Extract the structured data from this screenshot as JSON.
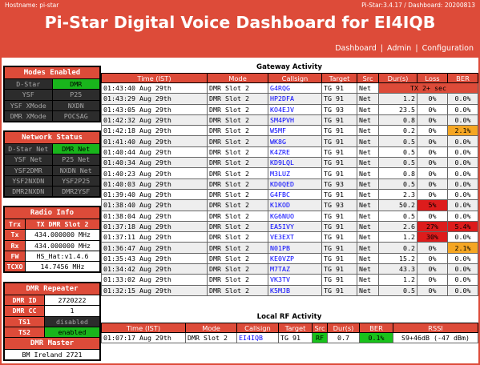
{
  "header": {
    "hostname": "Hostname: pi-star",
    "version": "Pi-Star:3.4.17 / Dashboard: 20200813",
    "title": "Pi-Star Digital Voice Dashboard for EI4IQB",
    "nav": [
      "Dashboard",
      "Admin",
      "Configuration"
    ]
  },
  "modes": {
    "title": "Modes Enabled",
    "items": [
      {
        "label": "D-Star",
        "on": false
      },
      {
        "label": "DMR",
        "on": true
      },
      {
        "label": "YSF",
        "on": false
      },
      {
        "label": "P25",
        "on": false
      },
      {
        "label": "YSF XMode",
        "on": false
      },
      {
        "label": "NXDN",
        "on": false
      },
      {
        "label": "DMR XMode",
        "on": false
      },
      {
        "label": "POCSAG",
        "on": false
      }
    ]
  },
  "network": {
    "title": "Network Status",
    "items": [
      {
        "label": "D-Star Net",
        "on": false
      },
      {
        "label": "DMR Net",
        "on": true
      },
      {
        "label": "YSF Net",
        "on": false
      },
      {
        "label": "P25 Net",
        "on": false
      },
      {
        "label": "YSF2DMR",
        "on": false
      },
      {
        "label": "NXDN Net",
        "on": false
      },
      {
        "label": "YSF2NXDN",
        "on": false
      },
      {
        "label": "YSF2P25",
        "on": false
      },
      {
        "label": "DMR2NXDN",
        "on": false
      },
      {
        "label": "DMR2YSF",
        "on": false
      }
    ]
  },
  "radio": {
    "title": "Radio Info",
    "rows": [
      {
        "label": "Trx",
        "value": "TX DMR Slot 2",
        "highlight": true
      },
      {
        "label": "Tx",
        "value": "434.000000 MHz",
        "highlight": false
      },
      {
        "label": "Rx",
        "value": "434.000000 MHz",
        "highlight": false
      },
      {
        "label": "FW",
        "value": "HS_Hat:v1.4.6",
        "highlight": false
      },
      {
        "label": "TCXO",
        "value": "14.7456 MHz",
        "highlight": false
      }
    ]
  },
  "repeater": {
    "title": "DMR Repeater",
    "rows": [
      {
        "label": "DMR ID",
        "value": "2720222",
        "state": "plain"
      },
      {
        "label": "DMR CC",
        "value": "1",
        "state": "plain"
      },
      {
        "label": "TS1",
        "value": "disabled",
        "state": "off"
      },
      {
        "label": "TS2",
        "value": "enabled",
        "state": "on"
      }
    ],
    "master_title": "DMR Master",
    "master_value": "BM Ireland 2721"
  },
  "gateway": {
    "title": "Gateway Activity",
    "columns": [
      "Time (IST)",
      "Mode",
      "Callsign",
      "Target",
      "Src",
      "Dur(s)",
      "Loss",
      "BER"
    ],
    "rows": [
      {
        "time": "01:43:40 Aug 29th",
        "mode": "DMR Slot 2",
        "callsign": "G4RQG",
        "target": "TG 91",
        "src": "Net",
        "dur": "",
        "loss": "",
        "ber": "",
        "tx": "TX 2+ sec"
      },
      {
        "time": "01:43:29 Aug 29th",
        "mode": "DMR Slot 2",
        "callsign": "HP2DFA",
        "target": "TG 91",
        "src": "Net",
        "dur": "1.2",
        "loss": "0%",
        "ber": "0.0%"
      },
      {
        "time": "01:43:05 Aug 29th",
        "mode": "DMR Slot 2",
        "callsign": "KO4EJV",
        "target": "TG 93",
        "src": "Net",
        "dur": "23.5",
        "loss": "0%",
        "ber": "0.0%"
      },
      {
        "time": "01:42:32 Aug 29th",
        "mode": "DMR Slot 2",
        "callsign": "SM4PVH",
        "target": "TG 91",
        "src": "Net",
        "dur": "0.8",
        "loss": "0%",
        "ber": "0.0%"
      },
      {
        "time": "01:42:18 Aug 29th",
        "mode": "DMR Slot 2",
        "callsign": "W5MF",
        "target": "TG 91",
        "src": "Net",
        "dur": "0.2",
        "loss": "0%",
        "ber": "2.1%",
        "ber_level": "warn"
      },
      {
        "time": "01:41:40 Aug 29th",
        "mode": "DMR Slot 2",
        "callsign": "WK8G",
        "target": "TG 91",
        "src": "Net",
        "dur": "0.5",
        "loss": "0%",
        "ber": "0.0%"
      },
      {
        "time": "01:40:44 Aug 29th",
        "mode": "DMR Slot 2",
        "callsign": "K4ZRE",
        "target": "TG 91",
        "src": "Net",
        "dur": "0.5",
        "loss": "0%",
        "ber": "0.0%"
      },
      {
        "time": "01:40:34 Aug 29th",
        "mode": "DMR Slot 2",
        "callsign": "KD9LQL",
        "target": "TG 91",
        "src": "Net",
        "dur": "0.5",
        "loss": "0%",
        "ber": "0.0%"
      },
      {
        "time": "01:40:23 Aug 29th",
        "mode": "DMR Slot 2",
        "callsign": "M3LUZ",
        "target": "TG 91",
        "src": "Net",
        "dur": "0.8",
        "loss": "0%",
        "ber": "0.0%"
      },
      {
        "time": "01:40:03 Aug 29th",
        "mode": "DMR Slot 2",
        "callsign": "KD0QED",
        "target": "TG 93",
        "src": "Net",
        "dur": "0.5",
        "loss": "0%",
        "ber": "0.0%"
      },
      {
        "time": "01:39:40 Aug 29th",
        "mode": "DMR Slot 2",
        "callsign": "G4FBC",
        "target": "TG 91",
        "src": "Net",
        "dur": "2.3",
        "loss": "0%",
        "ber": "0.0%"
      },
      {
        "time": "01:38:40 Aug 29th",
        "mode": "DMR Slot 2",
        "callsign": "K1KOD",
        "target": "TG 93",
        "src": "Net",
        "dur": "50.2",
        "loss": "5%",
        "ber": "0.0%",
        "loss_level": "bad"
      },
      {
        "time": "01:38:04 Aug 29th",
        "mode": "DMR Slot 2",
        "callsign": "KG6NUO",
        "target": "TG 91",
        "src": "Net",
        "dur": "0.5",
        "loss": "0%",
        "ber": "0.0%"
      },
      {
        "time": "01:37:18 Aug 29th",
        "mode": "DMR Slot 2",
        "callsign": "EA5IVY",
        "target": "TG 91",
        "src": "Net",
        "dur": "2.6",
        "loss": "27%",
        "ber": "5.4%",
        "loss_level": "bad",
        "ber_level": "bad"
      },
      {
        "time": "01:37:11 Aug 29th",
        "mode": "DMR Slot 2",
        "callsign": "VE3EXT",
        "target": "TG 91",
        "src": "Net",
        "dur": "1.2",
        "loss": "30%",
        "ber": "0.0%",
        "loss_level": "bad"
      },
      {
        "time": "01:36:47 Aug 29th",
        "mode": "DMR Slot 2",
        "callsign": "N01PB",
        "target": "TG 91",
        "src": "Net",
        "dur": "0.2",
        "loss": "0%",
        "ber": "2.1%",
        "ber_level": "warn"
      },
      {
        "time": "01:35:43 Aug 29th",
        "mode": "DMR Slot 2",
        "callsign": "KE0VZP",
        "target": "TG 91",
        "src": "Net",
        "dur": "15.2",
        "loss": "0%",
        "ber": "0.0%"
      },
      {
        "time": "01:34:42 Aug 29th",
        "mode": "DMR Slot 2",
        "callsign": "M7TAZ",
        "target": "TG 91",
        "src": "Net",
        "dur": "43.3",
        "loss": "0%",
        "ber": "0.0%"
      },
      {
        "time": "01:33:02 Aug 29th",
        "mode": "DMR Slot 2",
        "callsign": "VK3TV",
        "target": "TG 91",
        "src": "Net",
        "dur": "1.2",
        "loss": "0%",
        "ber": "0.0%"
      },
      {
        "time": "01:32:15 Aug 29th",
        "mode": "DMR Slot 2",
        "callsign": "K5MJB",
        "target": "TG 91",
        "src": "Net",
        "dur": "0.5",
        "loss": "0%",
        "ber": "0.0%"
      }
    ]
  },
  "localrf": {
    "title": "Local RF Activity",
    "columns": [
      "Time (IST)",
      "Mode",
      "Callsign",
      "Target",
      "Src",
      "Dur(s)",
      "BER",
      "RSSI"
    ],
    "rows": [
      {
        "time": "01:07:17 Aug 29th",
        "mode": "DMR Slot 2",
        "callsign": "EI4IQB",
        "target": "TG 91",
        "src": "RF",
        "dur": "0.7",
        "ber": "0.1%",
        "rssi": "S9+46dB (-47 dBm)"
      }
    ]
  }
}
